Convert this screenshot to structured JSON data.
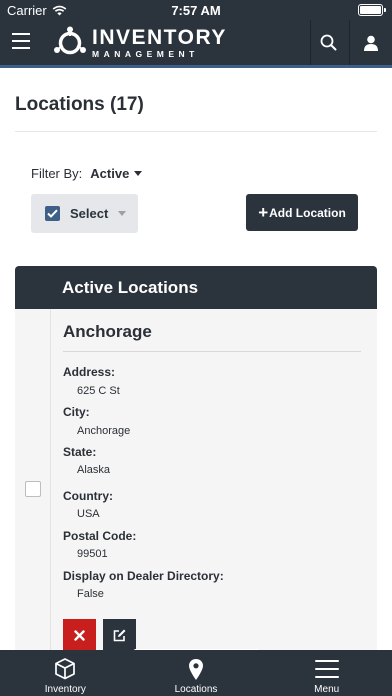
{
  "status_bar": {
    "carrier": "Carrier",
    "time": "7:57 AM"
  },
  "header": {
    "brand_line1": "INVENTORY",
    "brand_line2": "MANAGEMENT",
    "menu_icon": "hamburger-icon",
    "search_icon": "search-icon",
    "account_icon": "user-icon"
  },
  "page": {
    "title": "Locations (17)"
  },
  "filter": {
    "label": "Filter By:",
    "value": "Active"
  },
  "toolbar": {
    "select_label": "Select",
    "add_label": "Add Location",
    "add_plus": "+"
  },
  "panel": {
    "title": "Active Locations"
  },
  "location": {
    "name": "Anchorage",
    "fields": [
      {
        "label": "Address:",
        "value": "625 C St"
      },
      {
        "label": "City:",
        "value": "Anchorage"
      },
      {
        "label": "State:",
        "value": "Alaska"
      },
      {
        "label": "Country:",
        "value": "USA"
      },
      {
        "label": "Postal Code:",
        "value": "99501"
      },
      {
        "label": "Display on Dealer Directory:",
        "value": "False"
      }
    ]
  },
  "tabs": [
    {
      "label": "Inventory",
      "icon": "cube-icon"
    },
    {
      "label": "Locations",
      "icon": "map-pin-icon"
    },
    {
      "label": "Menu",
      "icon": "hamburger-icon"
    }
  ],
  "colors": {
    "header": "#2b333d",
    "accent": "#3e5f87",
    "delete": "#c81e1e"
  }
}
